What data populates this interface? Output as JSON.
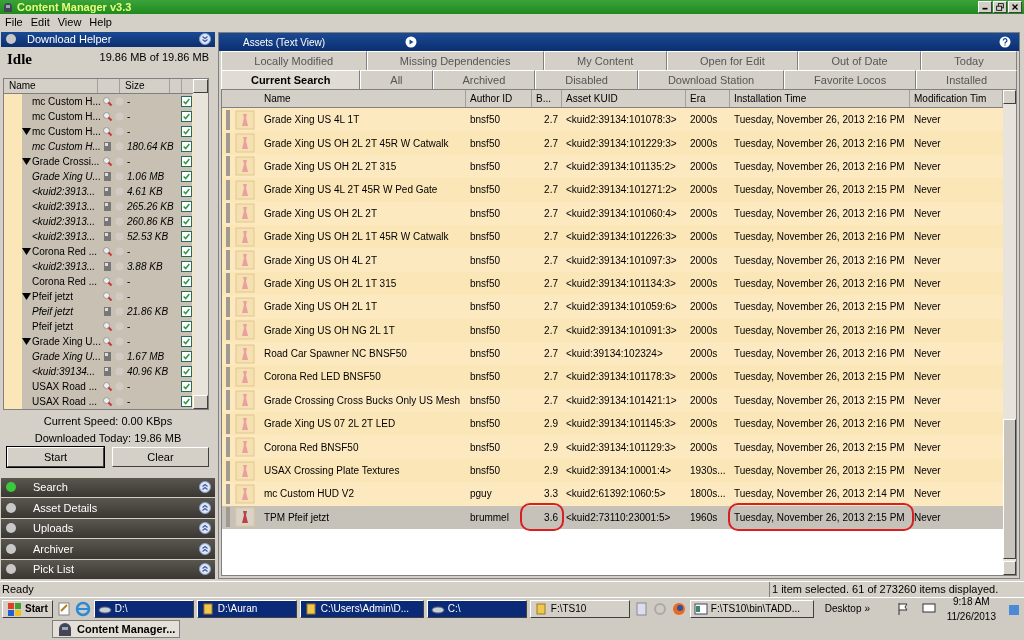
{
  "window": {
    "title": "Content Manager v3.3"
  },
  "menu": [
    "File",
    "Edit",
    "View",
    "Help"
  ],
  "download_helper": {
    "title": "Download Helper",
    "status": "Idle",
    "progress_text": "19.86 MB of 19.86 MB",
    "columns": [
      "Name",
      "Size"
    ],
    "items": [
      {
        "name": "mc Custom H...",
        "size": "-",
        "checked": true
      },
      {
        "name": "mc Custom H...",
        "size": "-",
        "checked": true
      },
      {
        "name": "mc Custom H...",
        "size": "-",
        "checked": true,
        "expanded": true,
        "children": [
          {
            "name": "mc Custom H...",
            "size": "180.64 KB",
            "checked": true
          }
        ]
      },
      {
        "name": "Grade Crossi...",
        "size": "-",
        "checked": true,
        "expanded": true,
        "children": [
          {
            "name": "Grade Xing U...",
            "size": "1.06 MB",
            "checked": true
          },
          {
            "name": "<kuid2:3913...",
            "size": "4.61 KB",
            "checked": true
          },
          {
            "name": "<kuid2:3913...",
            "size": "265.26 KB",
            "checked": true
          },
          {
            "name": "<kuid2:3913...",
            "size": "260.86 KB",
            "checked": true
          },
          {
            "name": "<kuid2:3913...",
            "size": "52.53 KB",
            "checked": true
          }
        ]
      },
      {
        "name": "Corona Red ...",
        "size": "-",
        "checked": true,
        "expanded": true,
        "children": [
          {
            "name": "<kuid2:3913...",
            "size": "3.88 KB",
            "checked": true
          }
        ]
      },
      {
        "name": "Corona Red ...",
        "size": "-",
        "checked": true
      },
      {
        "name": "Pfeif jetzt",
        "size": "-",
        "checked": true,
        "expanded": true,
        "children": [
          {
            "name": "Pfeif jetzt",
            "size": "21.86 KB",
            "checked": true
          }
        ]
      },
      {
        "name": "Pfeif jetzt",
        "size": "-",
        "checked": true
      },
      {
        "name": "Grade Xing U...",
        "size": "-",
        "checked": true,
        "expanded": true,
        "children": [
          {
            "name": "Grade Xing U...",
            "size": "1.67 MB",
            "checked": true
          },
          {
            "name": "<kuid:39134...",
            "size": "40.96 KB",
            "checked": true
          }
        ]
      },
      {
        "name": "USAX Road ...",
        "size": "-",
        "checked": true
      },
      {
        "name": "USAX Road ...",
        "size": "-",
        "checked": true
      }
    ],
    "current_speed": "Current Speed: 0.00 KBps",
    "downloaded_today": "Downloaded Today: 19.86 MB",
    "buttons": [
      "Start",
      "Clear"
    ]
  },
  "panels": [
    {
      "label": "Search",
      "active": true
    },
    {
      "label": "Asset Details",
      "active": false
    },
    {
      "label": "Uploads",
      "active": false
    },
    {
      "label": "Archiver",
      "active": false
    },
    {
      "label": "Pick List",
      "active": false
    }
  ],
  "assets": {
    "title": "Assets (Text View)",
    "tab_rows": [
      [
        {
          "label": "Locally Modified",
          "selected": false
        },
        {
          "label": "Missing Dependencies",
          "selected": false
        },
        {
          "label": "My Content",
          "selected": false
        },
        {
          "label": "Open for Edit",
          "selected": false
        },
        {
          "label": "Out of Date",
          "selected": false
        },
        {
          "label": "Today",
          "selected": false
        }
      ],
      [
        {
          "label": "Current Search",
          "selected": true
        },
        {
          "label": "All",
          "selected": false
        },
        {
          "label": "Archived",
          "selected": false
        },
        {
          "label": "Disabled",
          "selected": false
        },
        {
          "label": "Download Station",
          "selected": false
        },
        {
          "label": "Favorite Locos",
          "selected": false
        },
        {
          "label": "Installed",
          "selected": false
        }
      ]
    ],
    "columns": [
      "Name",
      "Author ID",
      "B...",
      "Asset KUID",
      "Era",
      "Installation Time",
      "Modification Tim"
    ],
    "rows": [
      {
        "name": "Grade Xing US 4L 1T",
        "author": "bnsf50",
        "build": "2.7",
        "kuid": "<kuid2:39134:101078:3>",
        "era": "2000s",
        "installed": "Tuesday, November 26, 2013 2:16 PM",
        "modified": "Never",
        "selected": false
      },
      {
        "name": "Grade Xing US OH 2L 2T 45R W Catwalk",
        "author": "bnsf50",
        "build": "2.7",
        "kuid": "<kuid2:39134:101229:3>",
        "era": "2000s",
        "installed": "Tuesday, November 26, 2013 2:16 PM",
        "modified": "Never",
        "selected": false
      },
      {
        "name": "Grade Xing US OH 2L 2T 315",
        "author": "bnsf50",
        "build": "2.7",
        "kuid": "<kuid2:39134:101135:2>",
        "era": "2000s",
        "installed": "Tuesday, November 26, 2013 2:16 PM",
        "modified": "Never",
        "selected": false
      },
      {
        "name": "Grade Xing US 4L 2T 45R W Ped Gate",
        "author": "bnsf50",
        "build": "2.7",
        "kuid": "<kuid2:39134:101271:2>",
        "era": "2000s",
        "installed": "Tuesday, November 26, 2013 2:15 PM",
        "modified": "Never",
        "selected": false
      },
      {
        "name": "Grade Xing US OH 2L 2T",
        "author": "bnsf50",
        "build": "2.7",
        "kuid": "<kuid2:39134:101060:4>",
        "era": "2000s",
        "installed": "Tuesday, November 26, 2013 2:16 PM",
        "modified": "Never",
        "selected": false
      },
      {
        "name": "Grade Xing US OH 2L 1T 45R W Catwalk",
        "author": "bnsf50",
        "build": "2.7",
        "kuid": "<kuid2:39134:101226:3>",
        "era": "2000s",
        "installed": "Tuesday, November 26, 2013 2:16 PM",
        "modified": "Never",
        "selected": false
      },
      {
        "name": "Grade Xing US OH 4L 2T",
        "author": "bnsf50",
        "build": "2.7",
        "kuid": "<kuid2:39134:101097:3>",
        "era": "2000s",
        "installed": "Tuesday, November 26, 2013 2:16 PM",
        "modified": "Never",
        "selected": false
      },
      {
        "name": "Grade Xing US OH 2L 1T 315",
        "author": "bnsf50",
        "build": "2.7",
        "kuid": "<kuid2:39134:101134:3>",
        "era": "2000s",
        "installed": "Tuesday, November 26, 2013 2:16 PM",
        "modified": "Never",
        "selected": false
      },
      {
        "name": "Grade Xing US OH 2L 1T",
        "author": "bnsf50",
        "build": "2.7",
        "kuid": "<kuid2:39134:101059:6>",
        "era": "2000s",
        "installed": "Tuesday, November 26, 2013 2:15 PM",
        "modified": "Never",
        "selected": false
      },
      {
        "name": "Grade Xing US OH NG 2L 1T",
        "author": "bnsf50",
        "build": "2.7",
        "kuid": "<kuid2:39134:101091:3>",
        "era": "2000s",
        "installed": "Tuesday, November 26, 2013 2:16 PM",
        "modified": "Never",
        "selected": false
      },
      {
        "name": "Road Car Spawner NC BNSF50",
        "author": "bnsf50",
        "build": "2.7",
        "kuid": "<kuid:39134:102324>",
        "era": "2000s",
        "installed": "Tuesday, November 26, 2013 2:16 PM",
        "modified": "Never",
        "selected": false
      },
      {
        "name": "Corona Red LED BNSF50",
        "author": "bnsf50",
        "build": "2.7",
        "kuid": "<kuid2:39134:101178:3>",
        "era": "2000s",
        "installed": "Tuesday, November 26, 2013 2:15 PM",
        "modified": "Never",
        "selected": false
      },
      {
        "name": "Grade Crossing Cross Bucks Only US Mesh",
        "author": "bnsf50",
        "build": "2.7",
        "kuid": "<kuid2:39134:101421:1>",
        "era": "2000s",
        "installed": "Tuesday, November 26, 2013 2:15 PM",
        "modified": "Never",
        "selected": false
      },
      {
        "name": "Grade Xing US 07 2L 2T LED",
        "author": "bnsf50",
        "build": "2.9",
        "kuid": "<kuid2:39134:101145:3>",
        "era": "2000s",
        "installed": "Tuesday, November 26, 2013 2:16 PM",
        "modified": "Never",
        "selected": false
      },
      {
        "name": "Corona Red BNSF50",
        "author": "bnsf50",
        "build": "2.9",
        "kuid": "<kuid2:39134:101129:3>",
        "era": "2000s",
        "installed": "Tuesday, November 26, 2013 2:15 PM",
        "modified": "Never",
        "selected": false
      },
      {
        "name": "USAX Crossing Plate Textures",
        "author": "bnsf50",
        "build": "2.9",
        "kuid": "<kuid2:39134:10001:4>",
        "era": "1930s...",
        "installed": "Tuesday, November 26, 2013 2:15 PM",
        "modified": "Never",
        "selected": false
      },
      {
        "name": "mc Custom HUD V2",
        "author": "pguy",
        "build": "3.3",
        "kuid": "<kuid2:61392:1060:5>",
        "era": "1800s...",
        "installed": "Tuesday, November 26, 2013 2:14 PM",
        "modified": "Never",
        "selected": false
      },
      {
        "name": "TPM Pfeif jetzt",
        "author": "brummel",
        "build": "3.6",
        "kuid": "<kuid2:73110:23001:5>",
        "era": "1960s",
        "installed": "Tuesday, November 26, 2013 2:15 PM",
        "modified": "Never",
        "selected": true
      }
    ]
  },
  "status_bar": {
    "left": "Ready",
    "right": "1 item selected. 61 of 273260 items displayed."
  },
  "taskbar": {
    "start": "Start",
    "windows": [
      {
        "label": "D:\\",
        "kind": "drive",
        "selected": true
      },
      {
        "label": "D:\\Auran",
        "kind": "folder",
        "selected": true
      },
      {
        "label": "C:\\Users\\Admin\\D...",
        "kind": "folder",
        "selected": true
      },
      {
        "label": "C:\\",
        "kind": "drive",
        "selected": true
      },
      {
        "label": "F:\\TS10",
        "kind": "folder",
        "selected": false
      },
      {
        "label": "F:\\TS10\\bin\\TADD...",
        "kind": "app",
        "selected": false
      }
    ],
    "desktop": "Desktop",
    "chevron": "»",
    "time": "9:18 AM",
    "date": "11/26/2013",
    "second_row": "Content Manager..."
  }
}
